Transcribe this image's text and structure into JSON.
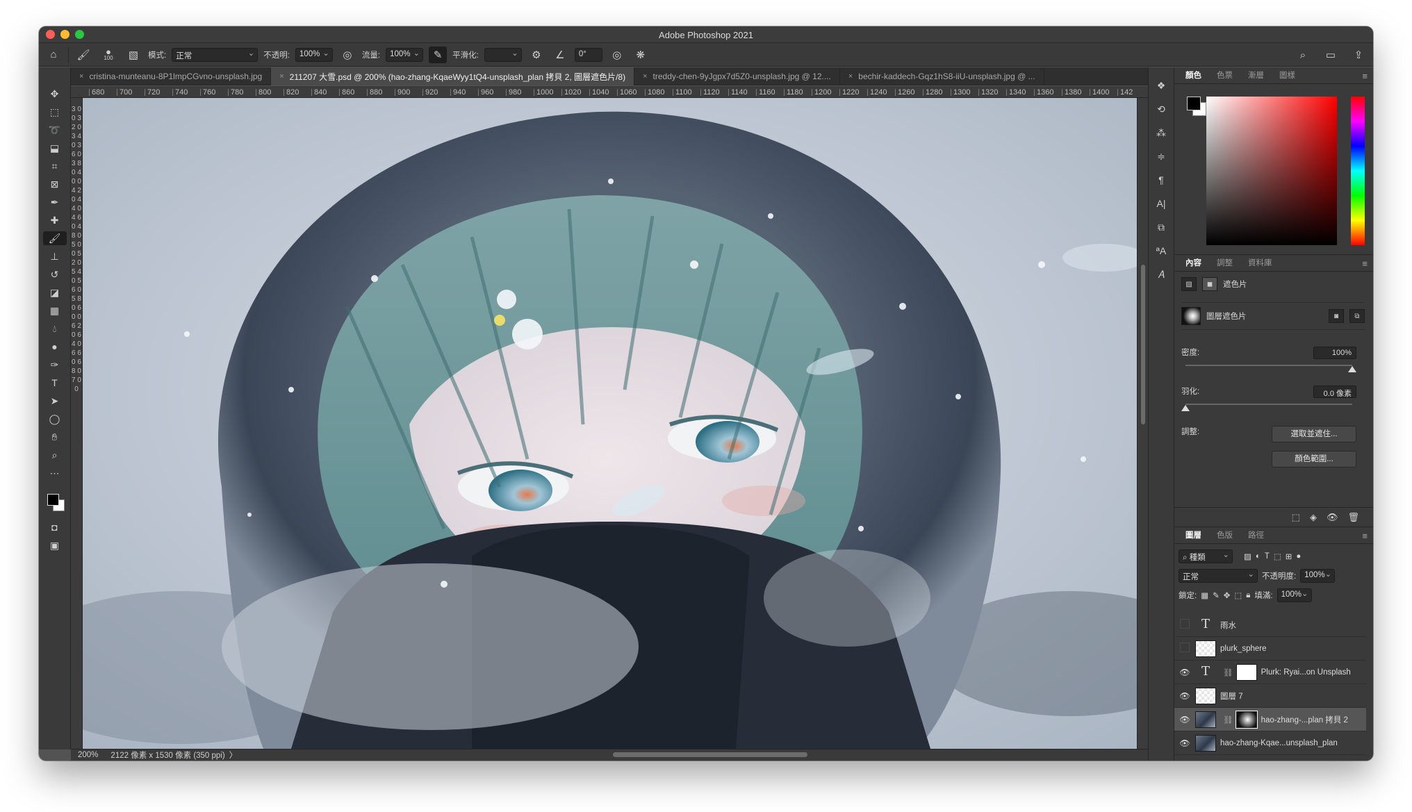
{
  "app": {
    "title": "Adobe Photoshop 2021"
  },
  "options": {
    "brush_size": "100",
    "mode_label": "模式:",
    "mode_value": "正常",
    "opacity_label": "不透明:",
    "opacity_value": "100%",
    "flow_label": "流量:",
    "flow_value": "100%",
    "smoothing_label": "平滑化:",
    "smoothing_value": "",
    "angle_value": "0°"
  },
  "tabs": [
    {
      "label": "cristina-munteanu-8P1lmpCGvno-unsplash.jpg"
    },
    {
      "label": "211207 大雪.psd @ 200% (hao-zhang-KqaeWyy1tQ4-unsplash_plan 拷貝 2, 圖層遮色片/8)"
    },
    {
      "label": "treddy-chen-9yJgpx7d5Z0-unsplash.jpg @ 12...."
    },
    {
      "label": "bechir-kaddech-Gqz1hS8-iiU-unsplash.jpg @ ..."
    }
  ],
  "ruler": {
    "h_ticks": [
      "680",
      "700",
      "720",
      "740",
      "760",
      "780",
      "800",
      "820",
      "840",
      "860",
      "880",
      "900",
      "920",
      "940",
      "960",
      "980",
      "1000",
      "1020",
      "1040",
      "1060",
      "1080",
      "1100",
      "1120",
      "1140",
      "1160",
      "1180",
      "1200",
      "1220",
      "1240",
      "1260",
      "1280",
      "1300",
      "1320",
      "1340",
      "1360",
      "1380",
      "1400",
      "142"
    ]
  },
  "status": {
    "zoom": "200%",
    "doc_info": "2122 像素 x 1530 像素 (350 ppi)",
    "arrow": "〉"
  },
  "color_panel": {
    "tabs": [
      "顏色",
      "色票",
      "漸層",
      "圖樣"
    ],
    "foreground": "#000000",
    "background": "#ffffff"
  },
  "properties": {
    "tabs": [
      "內容",
      "調整",
      "資料庫"
    ],
    "header": "遮色片",
    "mask_label": "圖層遮色片",
    "density_label": "密度:",
    "density_value": "100%",
    "feather_label": "羽化:",
    "feather_value": "0.0 像素",
    "adjust_label": "調整:",
    "select_mask_button": "選取並遮住...",
    "color_range_button": "顏色範圍..."
  },
  "layers_panel": {
    "tabs": [
      "圖層",
      "色版",
      "路徑"
    ],
    "filter_kind": "種類",
    "blend_mode": "正常",
    "opacity_label": "不透明度:",
    "opacity_value": "100%",
    "lock_label": "鎖定:",
    "fill_label": "填滿:",
    "fill_value": "100%",
    "layers": [
      {
        "name": "雨水",
        "kind": "text",
        "visible": false
      },
      {
        "name": "plurk_sphere",
        "kind": "pixel",
        "visible": false
      },
      {
        "name": "Plurk: Ryai...on Unsplash",
        "kind": "text-mask",
        "visible": true
      },
      {
        "name": "圖層 7",
        "kind": "pixel",
        "visible": true
      },
      {
        "name": "hao-zhang-...plan 拷貝 2",
        "kind": "photo-mask",
        "visible": true
      },
      {
        "name": "hao-zhang-Kqae...unsplash_plan",
        "kind": "photo",
        "visible": true
      }
    ]
  },
  "colors": {
    "accent": "#f2f2f2",
    "panel_bg": "#3a3a3a",
    "workspace": "#535353"
  }
}
